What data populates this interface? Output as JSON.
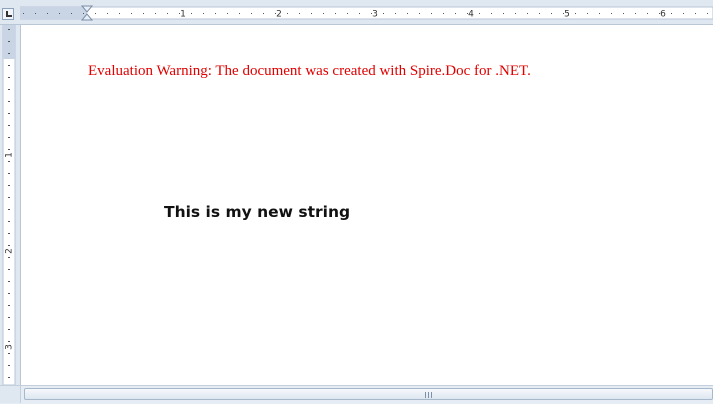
{
  "ruler": {
    "labels": [
      "1",
      "2",
      "3",
      "4",
      "5",
      "6"
    ],
    "vertical_labels": [
      "1",
      "2",
      "3"
    ]
  },
  "document": {
    "evaluation_warning": "Evaluation Warning: The document was created with Spire.Doc for .NET.",
    "body_text": "This is my new string"
  },
  "colors": {
    "warning_text": "#e00000",
    "ruler_background": "#dfe7f1"
  },
  "icons": {
    "tab_selector": "tab-stop-left-icon",
    "scroll_grip": "scroll-grip-icon"
  }
}
